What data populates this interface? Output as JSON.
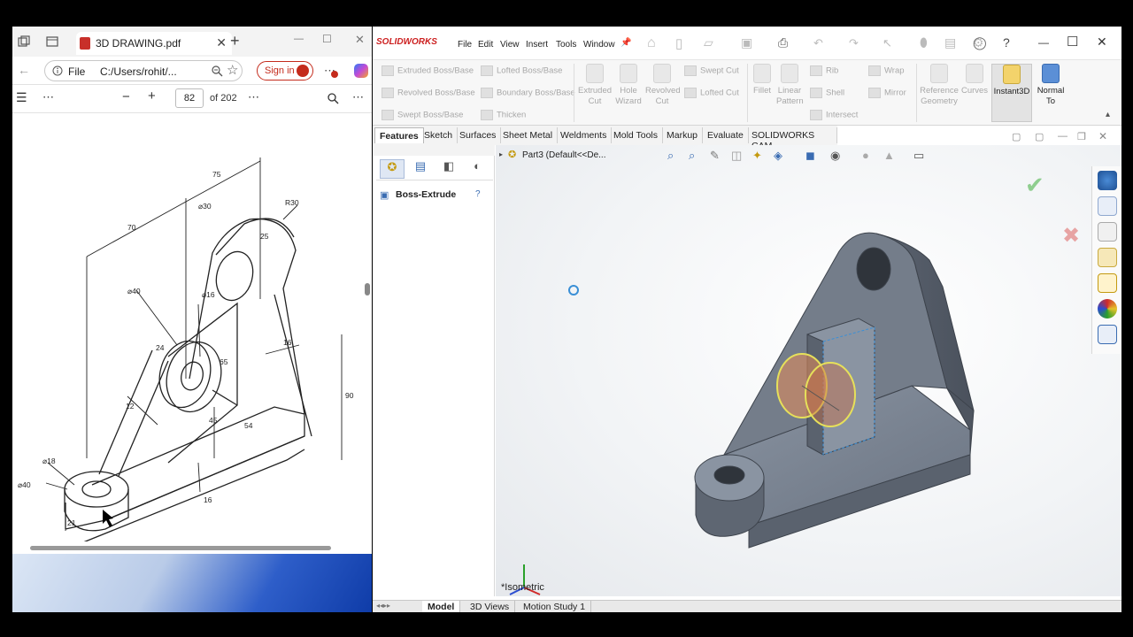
{
  "pdf": {
    "tab_title": "3D DRAWING.pdf",
    "address_label": "File",
    "address_path": "C:/Users/rohit/...",
    "sign_in": "Sign in",
    "page_current": "82",
    "page_total": "of 202",
    "drawing_dims": {
      "d75": "75",
      "d70": "70",
      "r30": "R30",
      "d30": "⌀30",
      "d25": "25",
      "d40top": "⌀40",
      "d16a": "⌀16",
      "d24": "24",
      "d65": "65",
      "d16b": "16",
      "d90": "90",
      "d12": "12",
      "d45": "45",
      "d54": "54",
      "d18": "⌀18",
      "d40bot": "⌀40",
      "d21": "21",
      "d16c": "16"
    }
  },
  "sw": {
    "logo": "SOLIDWORKS",
    "menu": [
      "File",
      "Edit",
      "View",
      "Insert",
      "Tools",
      "Window"
    ],
    "ribbon": {
      "extruded_boss": "Extruded Boss/Base",
      "revolved_boss": "Revolved Boss/Base",
      "swept_boss": "Swept Boss/Base",
      "lofted_boss": "Lofted Boss/Base",
      "boundary_boss": "Boundary Boss/Base",
      "thicken": "Thicken",
      "extruded_cut_1": "Extruded",
      "extruded_cut_2": "Cut",
      "hole_wizard_1": "Hole",
      "hole_wizard_2": "Wizard",
      "revolved_cut_1": "Revolved",
      "revolved_cut_2": "Cut",
      "swept_cut": "Swept Cut",
      "lofted_cut": "Lofted Cut",
      "fillet": "Fillet",
      "linear_1": "Linear",
      "linear_2": "Pattern",
      "rib": "Rib",
      "shell": "Shell",
      "intersect": "Intersect",
      "wrap": "Wrap",
      "mirror": "Mirror",
      "ref_1": "Reference",
      "ref_2": "Geometry",
      "curves": "Curves",
      "instant3d": "Instant3D",
      "normal_1": "Normal",
      "normal_2": "To"
    },
    "tabs": [
      "Features",
      "Sketch",
      "Surfaces",
      "Sheet Metal",
      "Weldments",
      "Mold Tools",
      "Markup",
      "Evaluate",
      "SOLIDWORKS CAM"
    ],
    "feature_title": "Boss-Extrude",
    "tree_root": "Part3  (Default<<De...",
    "view_label": "*Isometric",
    "bottom_tabs": [
      "Model",
      "3D Views",
      "Motion Study 1"
    ],
    "colors": {
      "accent": "#cc1f1f",
      "part": "#6f7a88"
    }
  }
}
